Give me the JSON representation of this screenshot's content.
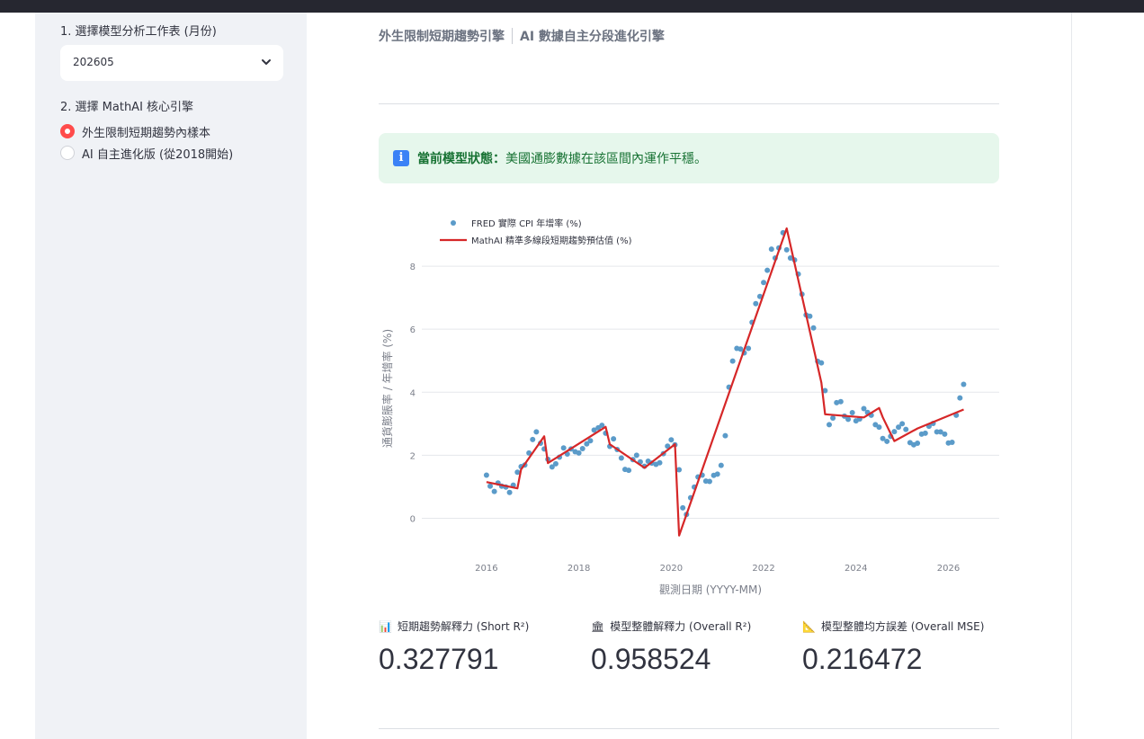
{
  "sidebar": {
    "worksheet_label": "1. 選擇模型分析工作表 (月份)",
    "worksheet_value": "202605",
    "engine_label": "2. 選擇 MathAI 核心引擎",
    "engine_options": [
      "外生限制短期趨勢內樣本",
      "AI 自主進化版 (從2018開始)"
    ],
    "engine_selected": 0
  },
  "header": {
    "tab1": "外生限制短期趨勢引擎",
    "tab2": "AI 數據自主分段進化引擎"
  },
  "status": {
    "title": "當前模型狀態：",
    "message": "美國通膨數據在該區間內運作平穩。"
  },
  "metrics": [
    {
      "icon": "bar-chart-icon",
      "glyph": "📊",
      "label": "短期趨勢解釋力 (Short R²)",
      "value": "0.327791"
    },
    {
      "icon": "bank-icon",
      "glyph": "🏛",
      "label": "模型整體解釋力 (Overall R²)",
      "value": "0.958524"
    },
    {
      "icon": "triangle-ruler-icon",
      "glyph": "📐",
      "label": "模型整體均方誤差 (Overall MSE)",
      "value": "0.216472"
    }
  ],
  "colors": {
    "accent": "#ff4b4b",
    "scatter": "#5b9bc9",
    "trend": "#d62728",
    "success_bg": "#e6f7ec",
    "success_text": "#177233"
  },
  "chart_data": {
    "type": "scatter",
    "xlabel": "觀測日期 (YYYY-MM)",
    "ylabel": "通貨膨脹率 / 年增率 (%)",
    "xlim": [
      2014.6,
      2027.1
    ],
    "ylim": [
      -0.9,
      9.6
    ],
    "xticks": [
      2016,
      2018,
      2020,
      2022,
      2024,
      2026
    ],
    "yticks": [
      0,
      2,
      4,
      6,
      8
    ],
    "legend_position": "top-left",
    "series": [
      {
        "name": "FRED 實際 CPI 年增率 (%)",
        "type": "scatter",
        "x": [
          2016.0,
          2016.08,
          2016.17,
          2016.25,
          2016.33,
          2016.42,
          2016.5,
          2016.58,
          2016.67,
          2016.75,
          2016.83,
          2016.92,
          2017.0,
          2017.08,
          2017.17,
          2017.25,
          2017.33,
          2017.42,
          2017.5,
          2017.58,
          2017.67,
          2017.75,
          2017.83,
          2017.92,
          2018.0,
          2018.08,
          2018.17,
          2018.25,
          2018.33,
          2018.42,
          2018.5,
          2018.58,
          2018.67,
          2018.75,
          2018.83,
          2018.92,
          2019.0,
          2019.08,
          2019.17,
          2019.25,
          2019.33,
          2019.42,
          2019.5,
          2019.58,
          2019.67,
          2019.75,
          2019.83,
          2019.92,
          2020.0,
          2020.08,
          2020.17,
          2020.25,
          2020.33,
          2020.42,
          2020.5,
          2020.58,
          2020.67,
          2020.75,
          2020.83,
          2020.92,
          2021.0,
          2021.08,
          2021.17,
          2021.25,
          2021.33,
          2021.42,
          2021.5,
          2021.58,
          2021.67,
          2021.75,
          2021.83,
          2021.92,
          2022.0,
          2022.08,
          2022.17,
          2022.25,
          2022.33,
          2022.42,
          2022.5,
          2022.58,
          2022.67,
          2022.75,
          2022.83,
          2022.92,
          2023.0,
          2023.08,
          2023.17,
          2023.25,
          2023.33,
          2023.42,
          2023.5,
          2023.58,
          2023.67,
          2023.75,
          2023.83,
          2023.92,
          2024.0,
          2024.08,
          2024.17,
          2024.25,
          2024.33,
          2024.42,
          2024.5,
          2024.58,
          2024.67,
          2024.75,
          2024.83,
          2024.92,
          2025.0,
          2025.08,
          2025.17,
          2025.25,
          2025.33,
          2025.42,
          2025.5,
          2025.58,
          2025.67,
          2025.75,
          2025.83,
          2025.92,
          2026.0,
          2026.08,
          2026.17,
          2026.25,
          2026.33
        ],
        "y": [
          1.37,
          1.02,
          0.85,
          1.12,
          1.02,
          0.99,
          0.82,
          1.05,
          1.46,
          1.64,
          1.69,
          2.07,
          2.5,
          2.74,
          2.38,
          2.2,
          1.87,
          1.63,
          1.73,
          1.94,
          2.23,
          2.04,
          2.2,
          2.11,
          2.07,
          2.21,
          2.36,
          2.46,
          2.8,
          2.87,
          2.95,
          2.7,
          2.28,
          2.52,
          2.18,
          1.91,
          1.55,
          1.52,
          1.86,
          2.0,
          1.79,
          1.65,
          1.81,
          1.75,
          1.71,
          1.76,
          2.05,
          2.29,
          2.49,
          2.33,
          1.54,
          0.33,
          0.12,
          0.65,
          0.99,
          1.31,
          1.37,
          1.18,
          1.17,
          1.36,
          1.4,
          1.68,
          2.62,
          4.16,
          4.99,
          5.39,
          5.37,
          5.25,
          5.39,
          6.22,
          6.81,
          7.04,
          7.48,
          7.87,
          8.54,
          8.26,
          8.58,
          9.06,
          8.52,
          8.26,
          8.2,
          7.75,
          7.11,
          6.45,
          6.41,
          6.04,
          4.98,
          4.93,
          4.05,
          2.97,
          3.18,
          3.67,
          3.7,
          3.24,
          3.14,
          3.35,
          3.09,
          3.15,
          3.48,
          3.36,
          3.27,
          2.97,
          2.89,
          2.53,
          2.44,
          2.6,
          2.75,
          2.89,
          3.0,
          2.82,
          2.4,
          2.33,
          2.38,
          2.67,
          2.7,
          2.92,
          3.01,
          2.74,
          2.74,
          2.67,
          2.39,
          2.41,
          3.27,
          3.82,
          4.25
        ]
      },
      {
        "name": "MathAI 精準多線段短期趨勢預估值 (%)",
        "type": "line",
        "x": [
          2016.0,
          2016.67,
          2016.75,
          2017.25,
          2017.33,
          2018.58,
          2018.67,
          2019.42,
          2020.08,
          2020.17,
          2022.5,
          2023.25,
          2023.33,
          2024.17,
          2024.5,
          2024.58,
          2024.83,
          2025.33,
          2026.33
        ],
        "y": [
          1.15,
          0.95,
          1.55,
          2.6,
          1.75,
          2.9,
          2.35,
          1.6,
          2.35,
          -0.55,
          9.2,
          4.3,
          3.3,
          3.2,
          3.5,
          3.2,
          2.45,
          2.85,
          3.45
        ]
      }
    ]
  }
}
